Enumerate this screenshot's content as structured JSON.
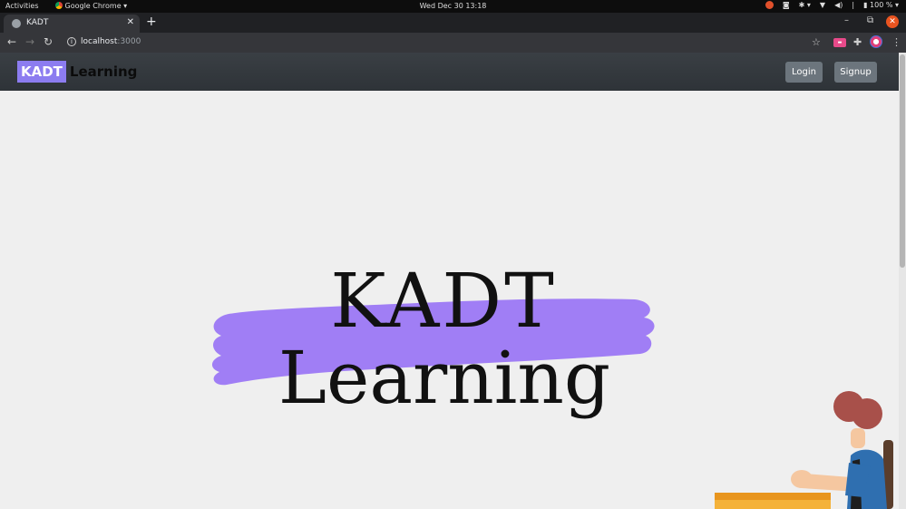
{
  "system_bar": {
    "activities": "Activities",
    "app_name": "Google Chrome",
    "clock": "Wed Dec 30  13:18",
    "battery": "100 %"
  },
  "browser": {
    "tab_title": "KADT",
    "new_tab_symbol": "+",
    "url_host": "localhost",
    "url_port": ":3000",
    "icons": [
      "back-icon",
      "forward-icon",
      "reload-icon",
      "info-icon",
      "star-icon",
      "extension-icon",
      "profile-icon",
      "menu-icon"
    ]
  },
  "navbar": {
    "brand_box": "KADT",
    "brand_text": "Learning",
    "login_label": "Login",
    "signup_label": "Signup"
  },
  "hero": {
    "line1": "KADT",
    "line2": "Learning",
    "highlight_color": "#a07ef5"
  },
  "colors": {
    "navbar_bg": "#343a40",
    "brand_accent": "#8c7cf0",
    "button_bg": "#6c757d",
    "page_bg": "#efefef"
  }
}
